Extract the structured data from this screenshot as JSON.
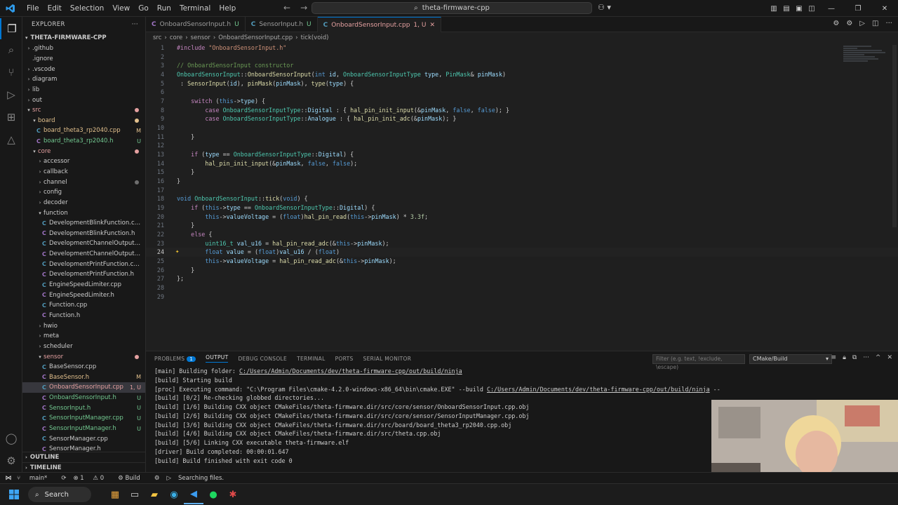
{
  "titlebar": {
    "menu": [
      "File",
      "Edit",
      "Selection",
      "View",
      "Go",
      "Run",
      "Terminal",
      "Help"
    ],
    "search": "theta-firmware-cpp"
  },
  "sidebar": {
    "title": "EXPLORER",
    "root": "THETA-FIRMWARE-CPP",
    "items": [
      {
        "label": ".github",
        "kind": "folder",
        "depth": 1,
        "open": false,
        "status": ""
      },
      {
        "label": ".ignore",
        "kind": "file",
        "depth": 1,
        "status": ""
      },
      {
        "label": ".vscode",
        "kind": "folder",
        "depth": 1,
        "open": false,
        "status": ""
      },
      {
        "label": "diagram",
        "kind": "folder",
        "depth": 1,
        "open": false,
        "status": ""
      },
      {
        "label": "lib",
        "kind": "folder",
        "depth": 1,
        "open": false,
        "status": ""
      },
      {
        "label": "out",
        "kind": "folder",
        "depth": 1,
        "open": false,
        "status": ""
      },
      {
        "label": "src",
        "kind": "folder",
        "depth": 1,
        "open": true,
        "status": "dot",
        "color": "#e4a0a0"
      },
      {
        "label": "board",
        "kind": "folder",
        "depth": 2,
        "open": true,
        "status": "dot",
        "color": "#e2c08d"
      },
      {
        "label": "board_theta3_rp2040.cpp",
        "kind": "cpp",
        "depth": 3,
        "status": "M",
        "color": "#e2c08d"
      },
      {
        "label": "board_theta3_rp2040.h",
        "kind": "h",
        "depth": 3,
        "status": "U",
        "color": "#73c991"
      },
      {
        "label": "core",
        "kind": "folder",
        "depth": 2,
        "open": true,
        "status": "dot",
        "color": "#e4a0a0"
      },
      {
        "label": "accessor",
        "kind": "folder",
        "depth": 3,
        "open": false,
        "status": ""
      },
      {
        "label": "callback",
        "kind": "folder",
        "depth": 3,
        "open": false,
        "status": ""
      },
      {
        "label": "channel",
        "kind": "folder",
        "depth": 3,
        "open": false,
        "status": "dot"
      },
      {
        "label": "config",
        "kind": "folder",
        "depth": 3,
        "open": false,
        "status": ""
      },
      {
        "label": "decoder",
        "kind": "folder",
        "depth": 3,
        "open": false,
        "status": ""
      },
      {
        "label": "function",
        "kind": "folder",
        "depth": 3,
        "open": true,
        "status": ""
      },
      {
        "label": "DevelopmentBlinkFunction.cpp",
        "kind": "cpp",
        "depth": 4,
        "status": ""
      },
      {
        "label": "DevelopmentBlinkFunction.h",
        "kind": "h",
        "depth": 4,
        "status": ""
      },
      {
        "label": "DevelopmentChannelOutputFunct...",
        "kind": "cpp",
        "depth": 4,
        "status": ""
      },
      {
        "label": "DevelopmentChannelOutputFunct...",
        "kind": "h",
        "depth": 4,
        "status": ""
      },
      {
        "label": "DevelopmentPrintFunction.cpp",
        "kind": "cpp",
        "depth": 4,
        "status": ""
      },
      {
        "label": "DevelopmentPrintFunction.h",
        "kind": "h",
        "depth": 4,
        "status": ""
      },
      {
        "label": "EngineSpeedLimiter.cpp",
        "kind": "cpp",
        "depth": 4,
        "status": ""
      },
      {
        "label": "EngineSpeedLimiter.h",
        "kind": "h",
        "depth": 4,
        "status": ""
      },
      {
        "label": "Function.cpp",
        "kind": "cpp",
        "depth": 4,
        "status": ""
      },
      {
        "label": "Function.h",
        "kind": "h",
        "depth": 4,
        "status": ""
      },
      {
        "label": "hwio",
        "kind": "folder",
        "depth": 3,
        "open": false,
        "status": ""
      },
      {
        "label": "meta",
        "kind": "folder",
        "depth": 3,
        "open": false,
        "status": ""
      },
      {
        "label": "scheduler",
        "kind": "folder",
        "depth": 3,
        "open": false,
        "status": ""
      },
      {
        "label": "sensor",
        "kind": "folder",
        "depth": 3,
        "open": true,
        "status": "dot",
        "color": "#e4a0a0"
      },
      {
        "label": "BaseSensor.cpp",
        "kind": "cpp",
        "depth": 4,
        "status": ""
      },
      {
        "label": "BaseSensor.h",
        "kind": "h",
        "depth": 4,
        "status": "M",
        "color": "#e2c08d"
      },
      {
        "label": "OnboardSensorInput.cpp",
        "kind": "cpp",
        "depth": 4,
        "status": "1, U",
        "color": "#e4a0a0",
        "selected": true
      },
      {
        "label": "OnboardSensorInput.h",
        "kind": "h",
        "depth": 4,
        "status": "U",
        "color": "#73c991"
      },
      {
        "label": "SensorInput.h",
        "kind": "h",
        "depth": 4,
        "status": "U",
        "color": "#73c991"
      },
      {
        "label": "SensorInputManager.cpp",
        "kind": "cpp",
        "depth": 4,
        "status": "U",
        "color": "#73c991"
      },
      {
        "label": "SensorInputManager.h",
        "kind": "h",
        "depth": 4,
        "status": "U",
        "color": "#73c991"
      },
      {
        "label": "SensorManager.cpp",
        "kind": "cpp",
        "depth": 4,
        "status": ""
      },
      {
        "label": "SensorManager.h",
        "kind": "h",
        "depth": 4,
        "status": ""
      }
    ],
    "outline": "OUTLINE",
    "timeline": "TIMELINE"
  },
  "tabs": [
    {
      "name": "OnboardSensorInput.h",
      "badge": "U",
      "icon": "C",
      "active": false
    },
    {
      "name": "SensorInput.h",
      "badge": "U",
      "icon": "C",
      "active": false
    },
    {
      "name": "OnboardSensorInput.cpp",
      "badge": "1, U",
      "icon": "C",
      "active": true
    }
  ],
  "breadcrumb": [
    "src",
    "core",
    "sensor",
    "OnboardSensorInput.cpp",
    "tick(void)"
  ],
  "editor": {
    "current_line": 24,
    "lines": [
      [
        [
          "pp",
          "#include "
        ],
        [
          "st",
          "\"OnboardSensorInput.h\""
        ]
      ],
      [],
      [
        [
          "cm",
          "// OnboardSensorInput constructor"
        ]
      ],
      [
        [
          "ty",
          "OnboardSensorInput"
        ],
        [
          "p",
          "::"
        ],
        [
          "fn",
          "OnboardSensorInput"
        ],
        [
          "p",
          "("
        ],
        [
          "kw",
          "int"
        ],
        [
          "p",
          " "
        ],
        [
          "vr",
          "id"
        ],
        [
          "p",
          ", "
        ],
        [
          "ty",
          "OnboardSensorInputType"
        ],
        [
          "p",
          " "
        ],
        [
          "vr",
          "type"
        ],
        [
          "p",
          ", "
        ],
        [
          "ty",
          "PinMask"
        ],
        [
          "p",
          "& "
        ],
        [
          "vr",
          "pinMask"
        ],
        [
          "p",
          ")"
        ]
      ],
      [
        [
          "p",
          " : "
        ],
        [
          "fn",
          "SensorInput"
        ],
        [
          "p",
          "("
        ],
        [
          "vr",
          "id"
        ],
        [
          "p",
          "), "
        ],
        [
          "fn",
          "pinMask"
        ],
        [
          "p",
          "("
        ],
        [
          "vr",
          "pinMask"
        ],
        [
          "p",
          "), "
        ],
        [
          "fn",
          "type"
        ],
        [
          "p",
          "("
        ],
        [
          "vr",
          "type"
        ],
        [
          "p",
          ") {"
        ]
      ],
      [],
      [
        [
          "p",
          "    "
        ],
        [
          "pp",
          "switch"
        ],
        [
          "p",
          " ("
        ],
        [
          "kw",
          "this"
        ],
        [
          "p",
          "->"
        ],
        [
          "vr",
          "type"
        ],
        [
          "p",
          ") {"
        ]
      ],
      [
        [
          "p",
          "        "
        ],
        [
          "pp",
          "case"
        ],
        [
          "p",
          " "
        ],
        [
          "ty",
          "OnboardSensorInputType"
        ],
        [
          "p",
          "::"
        ],
        [
          "vr",
          "Digital"
        ],
        [
          "p",
          " : { "
        ],
        [
          "fn",
          "hal_pin_init_input"
        ],
        [
          "p",
          "(&"
        ],
        [
          "vr",
          "pinMask"
        ],
        [
          "p",
          ", "
        ],
        [
          "kw",
          "false"
        ],
        [
          "p",
          ", "
        ],
        [
          "kw",
          "false"
        ],
        [
          "p",
          "); }"
        ]
      ],
      [
        [
          "p",
          "        "
        ],
        [
          "pp",
          "case"
        ],
        [
          "p",
          " "
        ],
        [
          "ty",
          "OnboardSensorInputType"
        ],
        [
          "p",
          "::"
        ],
        [
          "vr",
          "Analogue"
        ],
        [
          "p",
          " : { "
        ],
        [
          "fn",
          "hal_pin_init_adc"
        ],
        [
          "p",
          "(&"
        ],
        [
          "vr",
          "pinMask"
        ],
        [
          "p",
          "); }"
        ]
      ],
      [],
      [
        [
          "p",
          "    }"
        ]
      ],
      [],
      [
        [
          "p",
          "    "
        ],
        [
          "pp",
          "if"
        ],
        [
          "p",
          " ("
        ],
        [
          "vr",
          "type"
        ],
        [
          "p",
          " == "
        ],
        [
          "ty",
          "OnboardSensorInputType"
        ],
        [
          "p",
          "::"
        ],
        [
          "vr",
          "Digital"
        ],
        [
          "p",
          ") {"
        ]
      ],
      [
        [
          "p",
          "        "
        ],
        [
          "fn",
          "hal_pin_init_input"
        ],
        [
          "p",
          "(&"
        ],
        [
          "vr",
          "pinMask"
        ],
        [
          "p",
          ", "
        ],
        [
          "kw",
          "false"
        ],
        [
          "p",
          ", "
        ],
        [
          "kw",
          "false"
        ],
        [
          "p",
          ");"
        ]
      ],
      [
        [
          "p",
          "    }"
        ]
      ],
      [
        [
          "p",
          "}"
        ]
      ],
      [],
      [
        [
          "kw",
          "void"
        ],
        [
          "p",
          " "
        ],
        [
          "ty",
          "OnboardSensorInput"
        ],
        [
          "p",
          "::"
        ],
        [
          "fn",
          "tick"
        ],
        [
          "p",
          "("
        ],
        [
          "kw",
          "void"
        ],
        [
          "p",
          ") {"
        ]
      ],
      [
        [
          "p",
          "    "
        ],
        [
          "pp",
          "if"
        ],
        [
          "p",
          " ("
        ],
        [
          "kw",
          "this"
        ],
        [
          "p",
          "->"
        ],
        [
          "vr",
          "type"
        ],
        [
          "p",
          " == "
        ],
        [
          "ty",
          "OnboardSensorInputType"
        ],
        [
          "p",
          "::"
        ],
        [
          "vr",
          "Digital"
        ],
        [
          "p",
          ") {"
        ]
      ],
      [
        [
          "p",
          "        "
        ],
        [
          "kw",
          "this"
        ],
        [
          "p",
          "->"
        ],
        [
          "vr",
          "valueVoltage"
        ],
        [
          "p",
          " = ("
        ],
        [
          "kw",
          "float"
        ],
        [
          "p",
          ")"
        ],
        [
          "fn",
          "hal_pin_read"
        ],
        [
          "p",
          "("
        ],
        [
          "kw",
          "this"
        ],
        [
          "p",
          "->"
        ],
        [
          "vr",
          "pinMask"
        ],
        [
          "p",
          ") * "
        ],
        [
          "nu",
          "3.3f"
        ],
        [
          "p",
          ";"
        ]
      ],
      [
        [
          "p",
          "    }"
        ]
      ],
      [
        [
          "p",
          "    "
        ],
        [
          "pp",
          "else"
        ],
        [
          "p",
          " {"
        ]
      ],
      [
        [
          "p",
          "        "
        ],
        [
          "ty",
          "uint16_t"
        ],
        [
          "p",
          " "
        ],
        [
          "vr",
          "val_u16"
        ],
        [
          "p",
          " = "
        ],
        [
          "fn",
          "hal_pin_read_adc"
        ],
        [
          "p",
          "(&"
        ],
        [
          "kw",
          "this"
        ],
        [
          "p",
          "->"
        ],
        [
          "vr",
          "pinMask"
        ],
        [
          "p",
          ");"
        ]
      ],
      [
        [
          "p",
          "        "
        ],
        [
          "kw",
          "float"
        ],
        [
          "p",
          " "
        ],
        [
          "vr",
          "value"
        ],
        [
          "p",
          " = ("
        ],
        [
          "kw",
          "float"
        ],
        [
          "p",
          ")"
        ],
        [
          "vr",
          "val_u16"
        ],
        [
          "p",
          " / ("
        ],
        [
          "kw",
          "float"
        ],
        [
          "p",
          ")"
        ]
      ],
      [
        [
          "p",
          "        "
        ],
        [
          "kw",
          "this"
        ],
        [
          "p",
          "->"
        ],
        [
          "vr",
          "valueVoltage"
        ],
        [
          "p",
          " = "
        ],
        [
          "fn",
          "hal_pin_read_adc"
        ],
        [
          "p",
          "(&"
        ],
        [
          "kw",
          "this"
        ],
        [
          "p",
          "->"
        ],
        [
          "vr",
          "pinMask"
        ],
        [
          "p",
          ");"
        ]
      ],
      [
        [
          "p",
          "    }"
        ]
      ],
      [
        [
          "p",
          "};"
        ]
      ],
      [],
      []
    ]
  },
  "panel": {
    "tabs": [
      "PROBLEMS",
      "OUTPUT",
      "DEBUG CONSOLE",
      "TERMINAL",
      "PORTS",
      "SERIAL MONITOR"
    ],
    "active_tab": "OUTPUT",
    "problems_count": "1",
    "filter_placeholder": "Filter (e.g. text, !exclude, \\escape)",
    "task": "CMake/Build",
    "output": [
      {
        "pre": "[main] Building folder: ",
        "link": "C:/Users/Admin/Documents/dev/theta-firmware-cpp/out/build/ninja",
        "post": ""
      },
      {
        "pre": "[build] Starting build",
        "link": "",
        "post": ""
      },
      {
        "pre": "[proc] Executing command: \"C:\\Program Files\\cmake-4.2.0-windows-x86_64\\bin\\cmake.EXE\" --build ",
        "link": "C:/Users/Admin/Documents/dev/theta-firmware-cpp/out/build/ninja",
        "post": " --"
      },
      {
        "pre": "[build] [0/2] Re-checking globbed directories...",
        "link": "",
        "post": ""
      },
      {
        "pre": "[build] [1/6] Building CXX object CMakeFiles/theta-firmware.dir/src/core/sensor/OnboardSensorInput.cpp.obj",
        "link": "",
        "post": ""
      },
      {
        "pre": "[build] [2/6] Building CXX object CMakeFiles/theta-firmware.dir/src/core/sensor/SensorInputManager.cpp.obj",
        "link": "",
        "post": ""
      },
      {
        "pre": "[build] [3/6] Building CXX object CMakeFiles/theta-firmware.dir/src/board/board_theta3_rp2040.cpp.obj",
        "link": "",
        "post": ""
      },
      {
        "pre": "[build] [4/6] Building CXX object CMakeFiles/theta-firmware.dir/src/theta.cpp.obj",
        "link": "",
        "post": ""
      },
      {
        "pre": "[build] [5/6] Linking CXX executable theta-firmware.elf",
        "link": "",
        "post": ""
      },
      {
        "pre": "[driver] Build completed: 00:00:01.647",
        "link": "",
        "post": ""
      },
      {
        "pre": "[build] Build finished with exit code 0",
        "link": "",
        "post": ""
      }
    ]
  },
  "statusbar": {
    "branch": "main*",
    "errors": "1",
    "warnings": "0",
    "build": "Build",
    "message": "Searching files."
  },
  "taskbar": {
    "search": "Search"
  }
}
